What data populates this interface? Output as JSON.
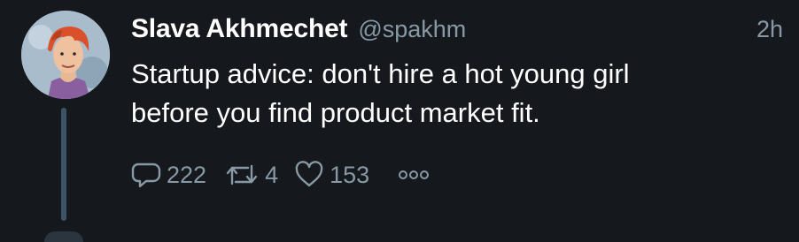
{
  "tweet": {
    "display_name": "Slava Akhmechet",
    "handle": "@spakhm",
    "timestamp": "2h",
    "text": "Startup advice: don't hire a hot young girl\nbefore you find product market fit.",
    "reply_count": "222",
    "retweet_count": "4",
    "like_count": "153"
  },
  "icons": {
    "reply": "reply-icon",
    "retweet": "retweet-icon",
    "like": "heart-icon",
    "more": "more-icon"
  },
  "colors": {
    "background": "#15181c",
    "primary_text": "#ffffff",
    "secondary_text": "#8899a6",
    "thread_line": "#3d5466"
  }
}
